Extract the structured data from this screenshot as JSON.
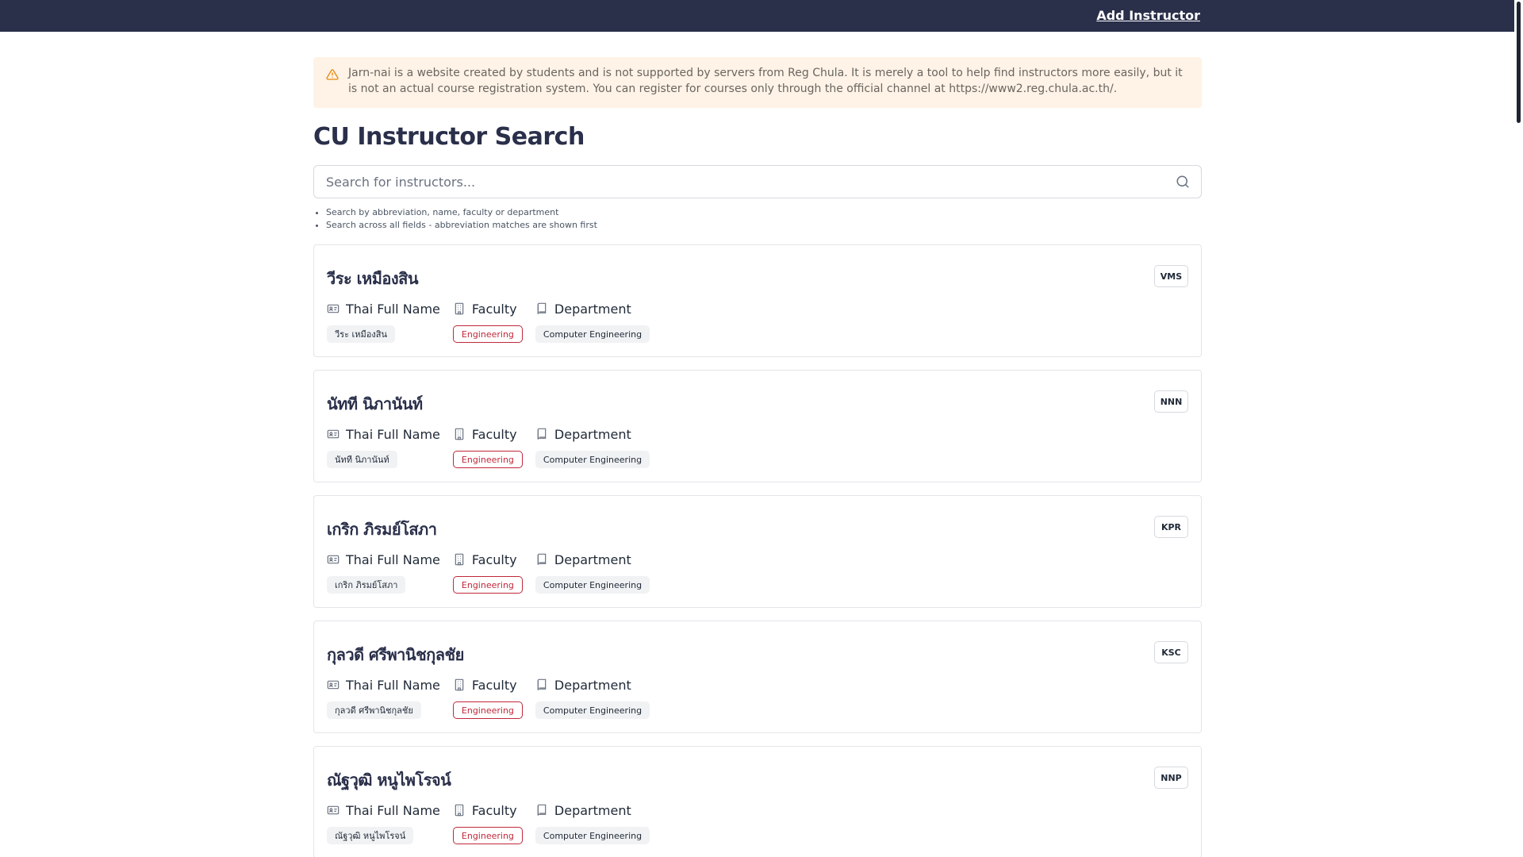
{
  "nav": {
    "add_instructor": "Add Instructor"
  },
  "alert": {
    "icon": "warning-triangle-icon",
    "color": "#fef3e6",
    "text": "Jarn-nai is a website created by students and is not supported by servers from Reg Chula. It is merely a tool to help find instructors more easily, but it is not an actual course registration system. You can register for courses only through the official channel at https://www2.reg.chula.ac.th/."
  },
  "page": {
    "title": "CU Instructor Search"
  },
  "search": {
    "placeholder": "Search for instructors...",
    "value": "",
    "icon": "search-icon",
    "hints": [
      "Search by abbreviation, name, faculty or department",
      "Search across all fields - abbreviation matches are shown first"
    ]
  },
  "labels": {
    "thai_full_name": "Thai Full Name",
    "faculty": "Faculty",
    "department": "Department"
  },
  "colors": {
    "header": "#2a2f4a",
    "faculty_accent": "#c0283a"
  },
  "instructors": [
    {
      "name": "วีระ เหมืองสิน",
      "abbr": "VMS",
      "thai_full_name": "วีระ เหมืองสิน",
      "faculty": "Engineering",
      "department": "Computer Engineering"
    },
    {
      "name": "นัทที นิภานันท์",
      "abbr": "NNN",
      "thai_full_name": "นัทที นิภานันท์",
      "faculty": "Engineering",
      "department": "Computer Engineering"
    },
    {
      "name": "เกริก ภิรมย์โสภา",
      "abbr": "KPR",
      "thai_full_name": "เกริก ภิรมย์โสภา",
      "faculty": "Engineering",
      "department": "Computer Engineering"
    },
    {
      "name": "กุลวดี ศรีพานิชกุลชัย",
      "abbr": "KSC",
      "thai_full_name": "กุลวดี ศรีพานิชกุลชัย",
      "faculty": "Engineering",
      "department": "Computer Engineering"
    },
    {
      "name": "ณัฐวุฒิ หนูไพโรจน์",
      "abbr": "NNP",
      "thai_full_name": "ณัฐวุฒิ หนูไพโรจน์",
      "faculty": "Engineering",
      "department": "Computer Engineering"
    }
  ]
}
